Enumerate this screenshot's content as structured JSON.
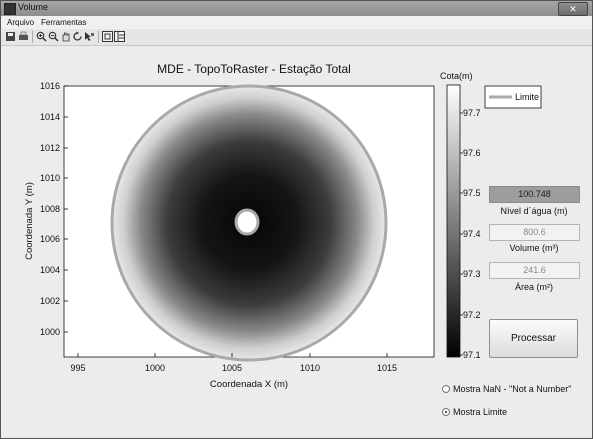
{
  "window": {
    "title": "Volume",
    "close_glyph": "✕"
  },
  "menu": {
    "items": [
      "Arquivo",
      "Ferramentas"
    ]
  },
  "toolbar": {
    "icons": [
      "save-icon",
      "print-icon",
      "zoom-in-icon",
      "zoom-out-icon",
      "pan-icon",
      "rotate-icon",
      "data-cursor-icon",
      "hide-plot-tools-icon",
      "show-plot-tools-icon"
    ]
  },
  "plot": {
    "title": "MDE - TopoToRaster - Estação Total",
    "xlabel": "Coordenada X (m)",
    "ylabel": "Coordenada Y (m)",
    "xticks": [
      "995",
      "1000",
      "1005",
      "1010",
      "1015"
    ],
    "yticks": [
      "1016",
      "1014",
      "1012",
      "1010",
      "1008",
      "1006",
      "1004",
      "1002",
      "1000"
    ],
    "legend": "Limite"
  },
  "colorbar": {
    "label": "Cota(m)",
    "ticks": [
      "97.7",
      "97.6",
      "97.5",
      "97.4",
      "97.3",
      "97.2",
      "97.1"
    ]
  },
  "panel": {
    "nivel_value": "100.748",
    "nivel_label": "Nível d´água (m)",
    "volume_value": "800.6",
    "volume_label": "Volume (m³)",
    "area_value": "241.6",
    "area_label": "Área (m²)",
    "process_button": "Processar"
  },
  "options": {
    "mostra_nan": {
      "label": "Mostra NaN - \"Not a Number\"",
      "checked": false
    },
    "mostra_limite": {
      "label": "Mostra Limite",
      "checked": true
    }
  }
}
